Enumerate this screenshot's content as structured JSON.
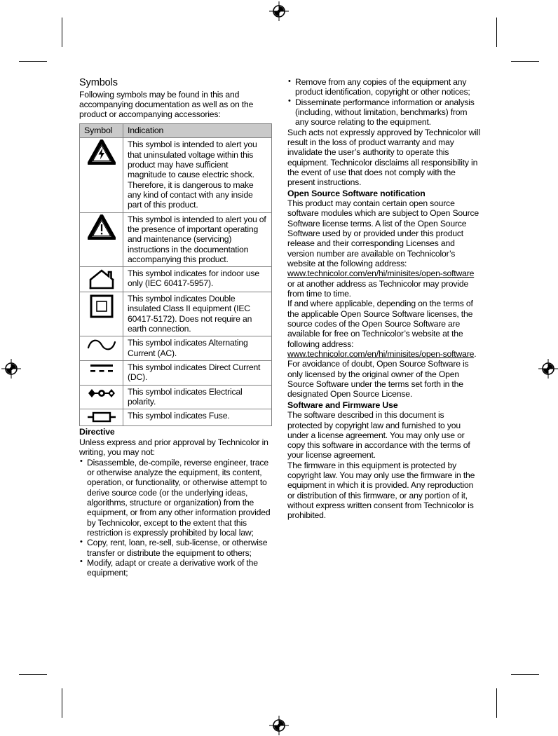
{
  "page": {
    "left_column": {
      "symbols_heading": "Symbols",
      "symbols_intro": "Following symbols may be found in this and accompanying documentation as well as on the product or accompanying accessories:",
      "table": {
        "headers": [
          "Symbol",
          "Indication"
        ],
        "rows": [
          {
            "icon": "high-voltage-triangle-icon",
            "indication": "This symbol is intended to alert you that uninsulated voltage within this product may have sufficient magnitude to cause electric shock. Therefore, it is dangerous to make any kind of contact with any inside part of this product."
          },
          {
            "icon": "warning-exclamation-triangle-icon",
            "indication": "This symbol is intended to alert you of the presence of important operating and maintenance (servicing) instructions in the documentation accompanying this product."
          },
          {
            "icon": "indoor-use-house-icon",
            "indication": "This symbol indicates for indoor use only (IEC 60417-5957)."
          },
          {
            "icon": "double-insulated-square-icon",
            "indication": "This symbol indicates Double insulated Class II equipment (IEC 60417-5172). Does not require an earth connection."
          },
          {
            "icon": "alternating-current-icon",
            "indication": "This symbol indicates Alternating Current (AC)."
          },
          {
            "icon": "direct-current-icon",
            "indication": "This symbol indicates Direct Current (DC)."
          },
          {
            "icon": "electrical-polarity-icon",
            "indication": "This symbol indicates Electrical polarity."
          },
          {
            "icon": "fuse-icon",
            "indication": "This symbol indicates Fuse."
          }
        ]
      },
      "directive_heading": "Directive",
      "directive_intro": "Unless express and prior approval by Technicolor in writing, you may not:",
      "directive_bullets": [
        "Disassemble, de-compile, reverse engineer, trace or otherwise analyze the equipment, its content, operation, or functionality, or otherwise attempt to derive source code (or the underlying ideas, algorithms, structure or organization) from the equipment, or from any other information provided by Technicolor, except to the extent that this restriction is expressly prohibited by local law;",
        "Copy, rent, loan, re-sell, sub-license, or otherwise transfer or distribute the equipment to others;",
        "Modify, adapt or create a derivative work of the equipment;"
      ]
    },
    "right_column": {
      "directive_bullets_continued": [
        "Remove from any copies of the equipment any product identification, copyright or other notices;",
        "Disseminate performance information or analysis (including, without limitation, benchmarks) from any source relating to the equipment."
      ],
      "such_acts_paragraph": "Such acts not expressly approved by Technicolor will result in the loss of product warranty and may invalidate the user’s authority to operate this equipment. Technicolor disclaims all responsibility in the event of use that does not comply with the present instructions.",
      "oss_heading": "Open Source Software notification",
      "oss_paragraph_1_before_link": "This product may contain certain open source software modules which are subject to Open Source Software license terms. A list of the Open Source Software used by or provided under this product release and their corresponding Licenses and version number are available on Technicolor’s website at the following address: ",
      "oss_link_1": "www.technicolor.com/en/hi/minisites/open-software",
      "oss_paragraph_1_after_link": " or at another address as Technicolor may provide from time to time.",
      "oss_paragraph_2_before_link": "If and where applicable, depending on the terms of the applicable Open Source Software licenses, the source codes of the Open Source Software are available for free on Technicolor’s website at the following address: ",
      "oss_link_2": "www.technicolor.com/en/hi/minisites/open-software",
      "oss_paragraph_2_after_link": ".",
      "oss_paragraph_3": "For avoidance of doubt, Open Source Software is only licensed by the original owner of the Open Source Software under the terms set forth in the designated Open Source License.",
      "sfu_heading": "Software and Firmware Use",
      "sfu_paragraph_1": "The software described in this document is protected by copyright law and furnished to you under a license agreement. You may only use or copy this software in accordance with the terms of your license agreement.",
      "sfu_paragraph_2": "The firmware in this equipment is protected by copyright law. You may only use the firmware in the equipment in which it is provided. Any reproduction or distribution of this firmware, or any portion of it, without express written consent from Technicolor is prohibited."
    }
  },
  "print_marks": {
    "registration_icon": "registration-target-icon",
    "crop_icon": "crop-mark"
  }
}
